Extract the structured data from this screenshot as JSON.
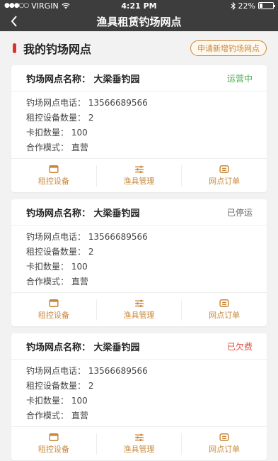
{
  "status_bar": {
    "carrier": "VIRGIN",
    "time": "4:21 PM",
    "battery": "22%",
    "battery_level": 0.22
  },
  "nav": {
    "title": "渔具租赁钓场网点"
  },
  "section": {
    "title": "我的钓场网点",
    "apply_button": "申请新增钓场网点"
  },
  "colors": {
    "accent": "#c9883a",
    "active": "#4caf50",
    "stopped": "#666666",
    "arrears": "#e0483b",
    "marker": "#d9342b"
  },
  "cards": [
    {
      "name": "钓场网点名称：  大梁垂钓园",
      "status": "运营中",
      "status_color": "#4caf50",
      "phone": "钓场网点电话：  13566689566",
      "devices": "租控设备数量：  2",
      "buckles": "卡扣数量：  100",
      "mode": "合作模式：  直营",
      "actions": [
        "租控设备",
        "渔具管理",
        "网点订单"
      ]
    },
    {
      "name": "钓场网点名称：  大梁垂钓园",
      "status": "已停运",
      "status_color": "#666666",
      "phone": "钓场网点电话：  13566689566",
      "devices": "租控设备数量：  2",
      "buckles": "卡扣数量：  100",
      "mode": "合作模式：  直营",
      "actions": [
        "租控设备",
        "渔具管理",
        "网点订单"
      ]
    },
    {
      "name": "钓场网点名称：  大梁垂钓园",
      "status": "已欠费",
      "status_color": "#e0483b",
      "phone": "钓场网点电话：  13566689566",
      "devices": "租控设备数量：  2",
      "buckles": "卡扣数量：  100",
      "mode": "合作模式：  直营",
      "actions": [
        "租控设备",
        "渔具管理",
        "网点订单"
      ]
    }
  ]
}
